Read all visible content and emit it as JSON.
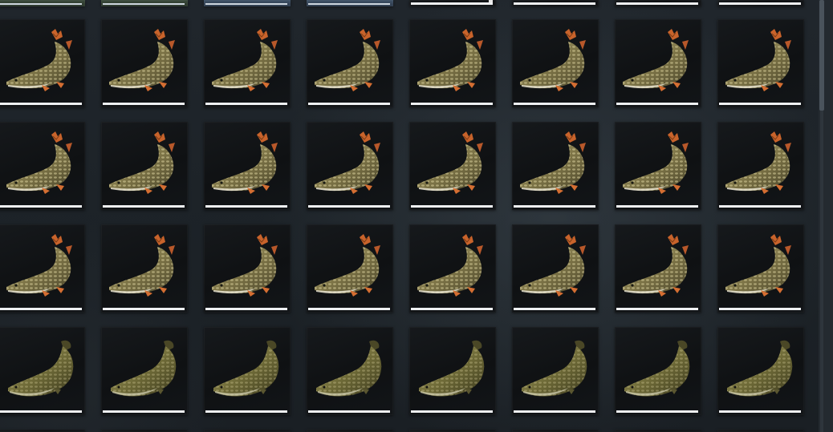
{
  "inventory": {
    "columns": 8,
    "top_row_states": [
      "green",
      "green",
      "blue",
      "blue",
      "plain-dot",
      "plain",
      "plain",
      "plain"
    ],
    "rows": [
      {
        "species_icon": "pike-icon"
      },
      {
        "species_icon": "pike-icon"
      },
      {
        "species_icon": "pike-icon"
      },
      {
        "species_icon": "burbot-icon"
      }
    ]
  },
  "colors": {
    "background": "#1f252b",
    "cell": "#121518",
    "condition_bar": "#eef0f2",
    "pike_body": "#8a8152",
    "pike_fins": "#c8632b",
    "burbot_body": "#6e6a3a"
  },
  "scroll": {
    "position": 0.0
  }
}
